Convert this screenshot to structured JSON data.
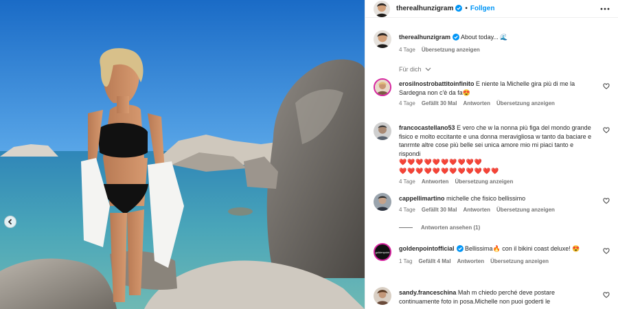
{
  "post": {
    "author": "therealhunzigram",
    "follow_label": "Follgen",
    "caption": "About today... 🌊",
    "caption_time": "4 Tage",
    "caption_translate": "Übersetzung anzeigen",
    "filter_label": "Für dich"
  },
  "comments": [
    {
      "user": "erosilnostrobattitoinfinito",
      "text": "E niente la Michelle gira più di me la Sardegna non c'è da fa😍",
      "time": "4 Tage",
      "likes": "Gefällt 30 Mal",
      "reply": "Antworten",
      "translate": "Übersetzung anzeigen"
    },
    {
      "user": "francocastellano53",
      "text": "E vero che w la nonna più figa del mondo grande fisico e molto eccitante e una donna meravigliosa w tanto da baciare e tanrmte altre cose più belle sei unica amore mio mi piaci tanto e rispondi",
      "hearts_line1": "❤️❤️❤️❤️❤️❤️❤️❤️❤️❤️",
      "hearts_line2": "❤️❤️❤️❤️❤️❤️❤️❤️❤️❤️❤️❤️",
      "time": "4 Tage",
      "reply": "Antworten",
      "translate": "Übersetzung anzeigen"
    },
    {
      "user": "cappellimartino",
      "text": "michelle che fisico bellissimo",
      "time": "4 Tage",
      "likes": "Gefällt 30 Mal",
      "reply": "Antworten",
      "translate": "Übersetzung anzeigen",
      "view_replies": "Antworten ansehen (1)"
    },
    {
      "user": "goldenpointofficial",
      "avatar_text": "goldenpoint",
      "text": "Bellissima🔥 con il bikini coast deluxe! 😍",
      "time": "1 Tag",
      "likes": "Gefällt 4 Mal",
      "reply": "Antworten",
      "translate": "Übersetzung anzeigen"
    },
    {
      "user": "sandy.franceschina",
      "text": "Mah m chiedo perché deve postare continuamente foto in posa.Michelle non puoi goderti le"
    }
  ],
  "colors": {
    "accent": "#0095f6",
    "verified": "#0095f6",
    "muted": "#737373",
    "sky": "#1f7fd6",
    "sea": "#3a8fb3"
  }
}
